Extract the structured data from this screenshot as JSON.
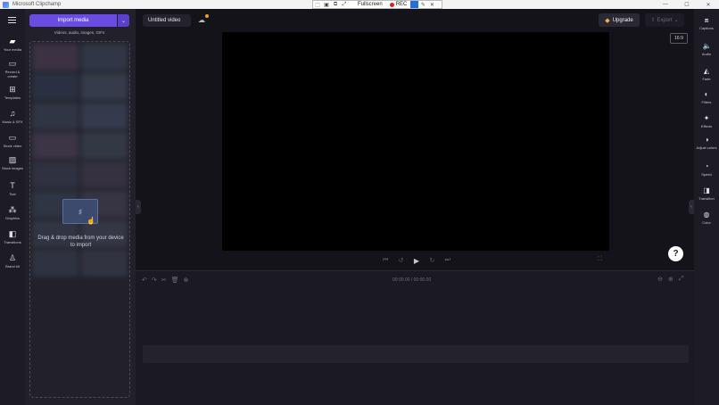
{
  "window": {
    "title": "Microsoft Clipchamp",
    "minimize": "—",
    "maximize": "☐",
    "close": "✕"
  },
  "recorder": {
    "fullscreen_label": "Fullscreen",
    "rec_label": "REC"
  },
  "nav": {
    "items": [
      {
        "label": "Your media",
        "icon": "film-icon"
      },
      {
        "label": "Record & create",
        "icon": "camera-icon"
      },
      {
        "label": "Templates",
        "icon": "templates-icon"
      },
      {
        "label": "Music & SFX",
        "icon": "music-icon"
      },
      {
        "label": "Stock video",
        "icon": "stock-video-icon"
      },
      {
        "label": "Stock images",
        "icon": "image-icon"
      },
      {
        "label": "Text",
        "icon": "text-icon"
      },
      {
        "label": "Graphics",
        "icon": "graphics-icon"
      },
      {
        "label": "Transitions",
        "icon": "transitions-icon"
      },
      {
        "label": "Brand kit",
        "icon": "brand-kit-icon"
      }
    ]
  },
  "media": {
    "import_label": "Import media",
    "import_sub": "Videos, audio, images, GIFs",
    "drop_text": "Drag & drop media from your device to import"
  },
  "header": {
    "video_title": "Untitled video",
    "upgrade_label": "Upgrade",
    "export_label": "Export",
    "accent": "#6a4ce0"
  },
  "preview": {
    "ratio": "16:9"
  },
  "timeline": {
    "current": "00:00.00",
    "total": "00:00.00"
  },
  "rightbar": {
    "items": [
      {
        "label": "Captions",
        "icon": "captions-icon"
      },
      {
        "label": "Audio",
        "icon": "speaker-icon"
      },
      {
        "label": "Fade",
        "icon": "fade-icon"
      },
      {
        "label": "Filters",
        "icon": "filters-icon"
      },
      {
        "label": "Effects",
        "icon": "effects-icon"
      },
      {
        "label": "Adjust colors",
        "icon": "adjust-colors-icon"
      },
      {
        "label": "Speed",
        "icon": "speed-icon"
      },
      {
        "label": "Transition",
        "icon": "transition-icon"
      },
      {
        "label": "Color",
        "icon": "color-icon"
      }
    ]
  }
}
